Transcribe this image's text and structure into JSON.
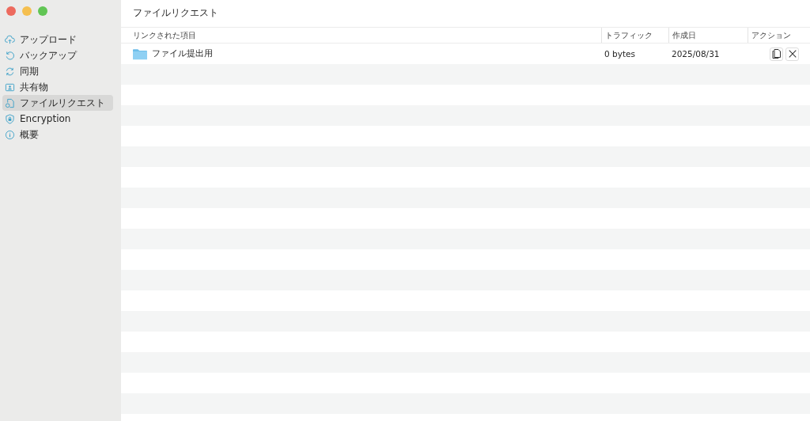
{
  "sidebar": {
    "items": [
      {
        "label": "アップロード",
        "kind": "upload",
        "selected": false
      },
      {
        "label": "バックアップ",
        "kind": "backup",
        "selected": false
      },
      {
        "label": "同期",
        "kind": "sync",
        "selected": false
      },
      {
        "label": "共有物",
        "kind": "shared",
        "selected": false
      },
      {
        "label": "ファイルリクエスト",
        "kind": "request",
        "selected": true
      },
      {
        "label": "Encryption",
        "kind": "lock",
        "selected": false
      },
      {
        "label": "概要",
        "kind": "info",
        "selected": false
      }
    ]
  },
  "page": {
    "title": "ファイルリクエスト"
  },
  "table": {
    "columns": [
      "リンクされた項目",
      "トラフィック",
      "作成日",
      "アクション"
    ],
    "rows": [
      {
        "name": "ファイル提出用",
        "traffic": "0 bytes",
        "created": "2025/08/31"
      }
    ]
  }
}
